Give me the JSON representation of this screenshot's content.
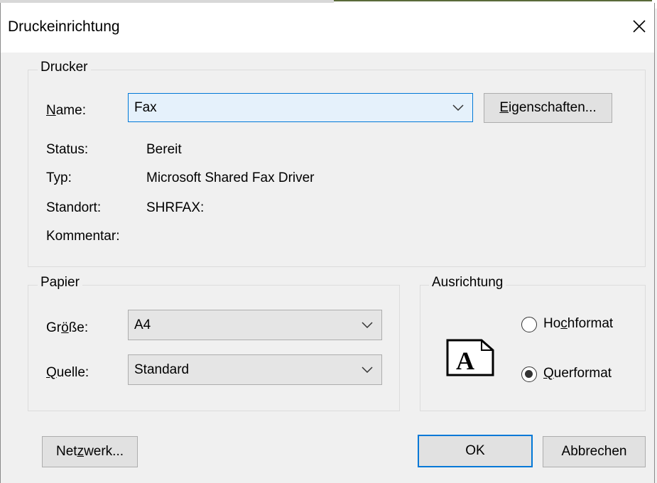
{
  "window": {
    "title": "Druckeinrichtung"
  },
  "printer": {
    "group_label": "Drucker",
    "name_label": "Name:",
    "name_value": "Fax",
    "properties_button": "Eigenschaften...",
    "status_label": "Status:",
    "status_value": "Bereit",
    "type_label": "Typ:",
    "type_value": "Microsoft Shared Fax Driver",
    "location_label": "Standort:",
    "location_value": "SHRFAX:",
    "comment_label": "Kommentar:",
    "comment_value": ""
  },
  "paper": {
    "group_label": "Papier",
    "size_label": "Größe:",
    "size_value": "A4",
    "source_label": "Quelle:",
    "source_value": "Standard"
  },
  "orientation": {
    "group_label": "Ausrichtung",
    "portrait_label": "Hochformat",
    "landscape_label": "Querformat",
    "selected": "landscape",
    "icon_letter": "A"
  },
  "buttons": {
    "network": "Netzwerk...",
    "ok": "OK",
    "cancel": "Abbrechen"
  },
  "colors": {
    "accent": "#0078d7",
    "background": "#f0f0f0"
  },
  "icons": {
    "close": "close-icon",
    "chevron": "chevron-down-icon",
    "page": "page-icon"
  }
}
